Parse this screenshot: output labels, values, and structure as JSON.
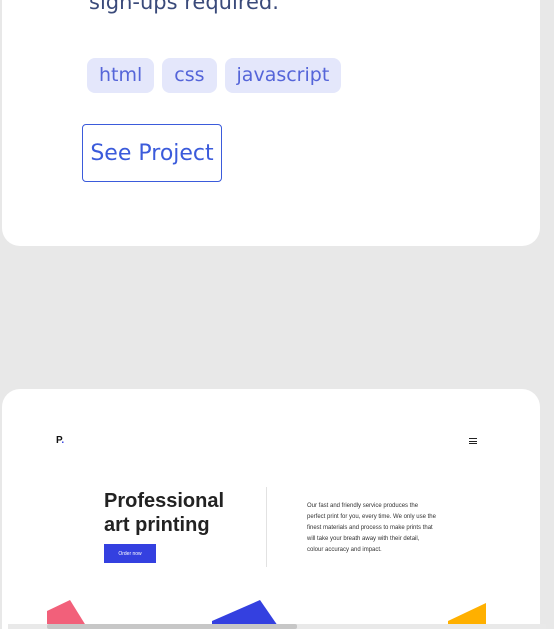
{
  "project_card": {
    "description_fragment": "sign-ups required.",
    "tags": [
      "html",
      "css",
      "javascript"
    ],
    "see_project_label": "See Project"
  },
  "preview": {
    "logo": "P",
    "logo_dot": ".",
    "headline": "Professional art printing",
    "order_button": "Order now",
    "paragraph": "Our fast and friendly service produces the perfect print for you, every time. We only use the finest materials and process to make prints that will take your breath away with their detail, colour accuracy and impact.",
    "colors": {
      "pink": "#f2607a",
      "blue": "#3440e0",
      "yellow": "#ffb000"
    }
  },
  "icons": {
    "menu": "hamburger-menu-icon"
  }
}
